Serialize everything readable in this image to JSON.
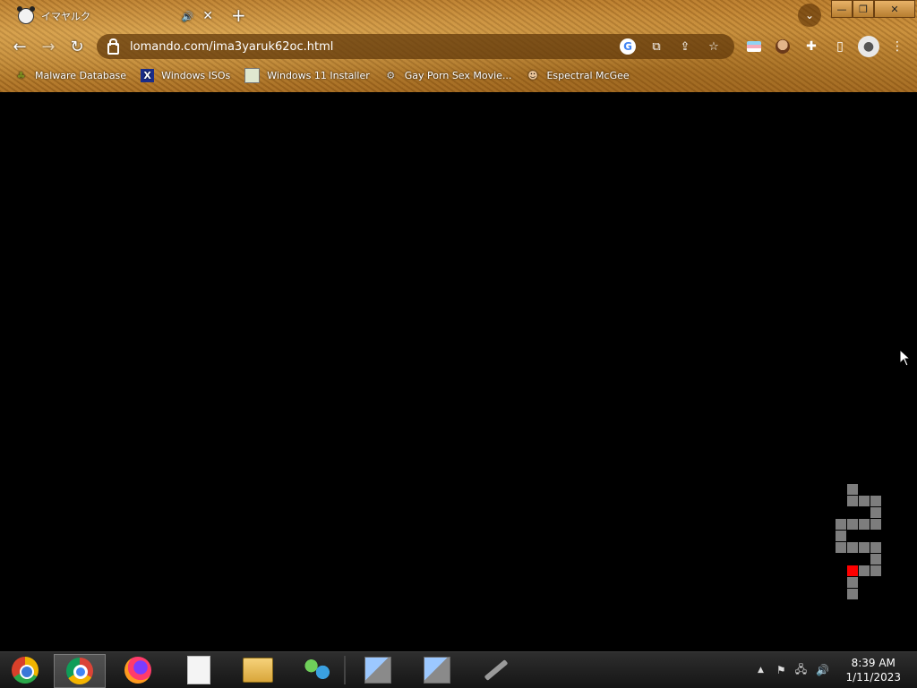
{
  "browser": {
    "tab": {
      "title": "イマヤルク",
      "audio_icon": "speaker-icon",
      "close_icon": "close-icon"
    },
    "new_tab_label": "+",
    "window_controls": {
      "minimize": "—",
      "restore": "❐",
      "close": "✕"
    },
    "address": {
      "url": "lomando.com/ima3yaruk62oc.html"
    },
    "bookmarks": [
      {
        "label": "Malware Database",
        "icon": "leaf-icon"
      },
      {
        "label": "Windows ISOs",
        "icon": "x-logo-icon"
      },
      {
        "label": "Windows 11 Installer",
        "icon": "image-icon"
      },
      {
        "label": "Gay Porn Sex Movie...",
        "icon": "gear-disk-icon"
      },
      {
        "label": "Espectral McGee",
        "icon": "face-icon"
      }
    ]
  },
  "page": {
    "background": "#000000",
    "game_grid": {
      "cell_color": "#7d7d7d",
      "highlight_color": "#ff0000"
    }
  },
  "taskbar": {
    "apps": [
      {
        "name": "chrome-canary-icon"
      },
      {
        "name": "chrome-icon",
        "active": true
      },
      {
        "name": "firefox-icon"
      },
      {
        "name": "blank-document-icon"
      },
      {
        "name": "file-explorer-icon"
      },
      {
        "name": "network-users-icon"
      },
      {
        "name": "installer-icon-1"
      },
      {
        "name": "installer-icon-2"
      },
      {
        "name": "sword-icon"
      }
    ],
    "tray": {
      "time": "8:39 AM",
      "date": "1/11/2023"
    }
  }
}
